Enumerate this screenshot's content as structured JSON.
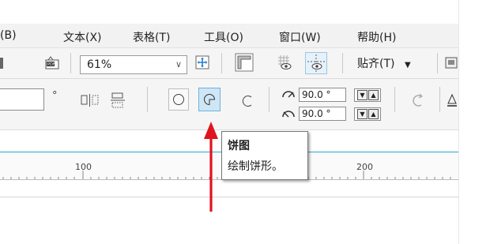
{
  "menu": {
    "items": [
      {
        "label": "(B)"
      },
      {
        "label": "文本(X)"
      },
      {
        "label": "表格(T)"
      },
      {
        "label": "工具(O)"
      },
      {
        "label": "窗口(W)"
      },
      {
        "label": "帮助(H)"
      }
    ]
  },
  "toolbar": {
    "zoom_value": "61%",
    "snap_label": "贴齐(T)"
  },
  "propbar": {
    "degree_symbol": "°",
    "start_angle": "90.0 °",
    "end_angle": "90.0 °"
  },
  "ruler": {
    "tick_labels": [
      "100",
      "200"
    ]
  },
  "tooltip": {
    "title": "饼图",
    "description": "绘制饼形。"
  },
  "colors": {
    "accent_blue": "#2aa7d8",
    "arrow_red": "#e0141e",
    "selected_fill": "#cfe6f5",
    "selected_border": "#6fb1dc"
  }
}
